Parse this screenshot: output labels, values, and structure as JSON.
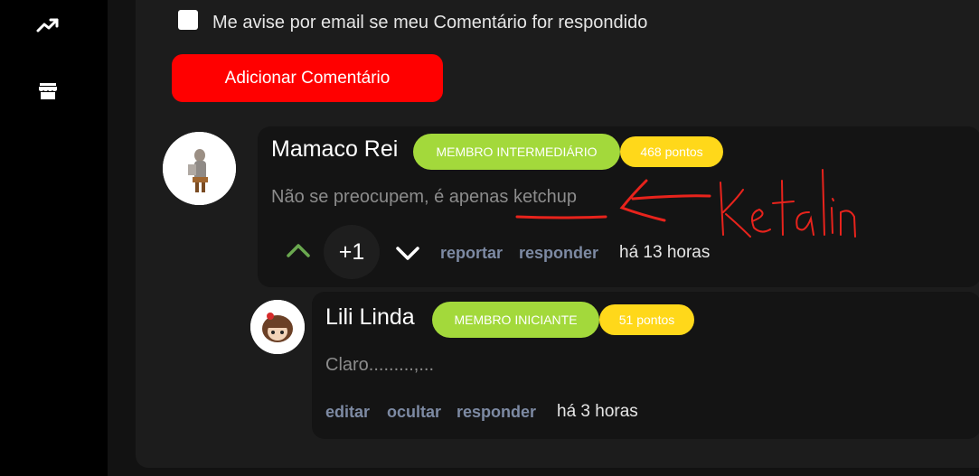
{
  "sidebar": {
    "icons": [
      "trending-up-icon",
      "store-icon"
    ]
  },
  "form": {
    "notify_label": "Me avise por email se meu Comentário for respondido",
    "add_button": "Adicionar Comentário"
  },
  "comments": [
    {
      "author": "Mamaco Rei",
      "badge": "MEMBRO INTERMEDIÁRIO",
      "points": "468 pontos",
      "text": "Não se preocupem, é apenas ketchup",
      "score": "+1",
      "actions": [
        "reportar",
        "responder"
      ],
      "time": "há 13 horas",
      "annotation": "Ketalin"
    },
    {
      "author": "Lili Linda",
      "badge": "MEMBRO INICIANTE",
      "points": "51 pontos",
      "text": "Claro.........,...",
      "actions": [
        "editar",
        "ocultar",
        "responder"
      ],
      "time": "há 3 horas"
    }
  ],
  "colors": {
    "accent_red": "#ff0000",
    "badge_green": "#a3d93b",
    "badge_yellow": "#ffd81a",
    "upvote_green": "#6aa84f",
    "annotation_red": "#e8231c"
  }
}
